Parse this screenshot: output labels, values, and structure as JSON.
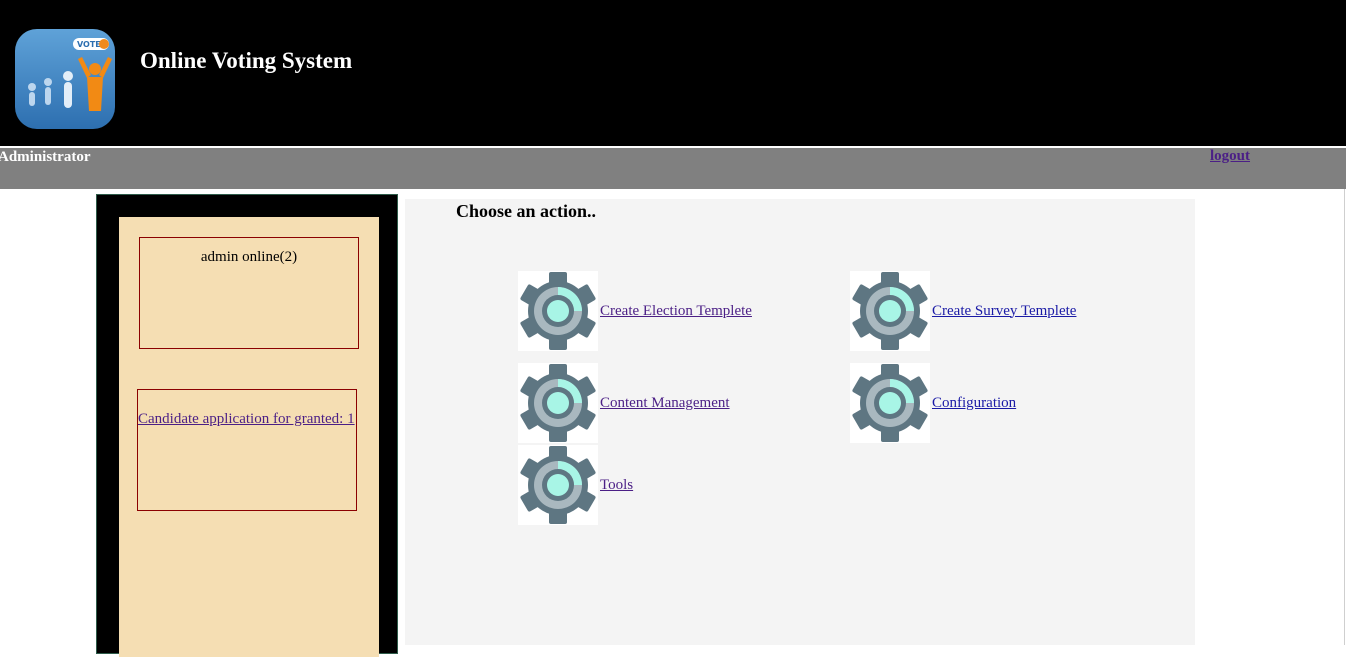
{
  "header": {
    "title": "Online Voting System",
    "logo_badge": "VOTE"
  },
  "topbar": {
    "role": "Administrator",
    "logout": "logout"
  },
  "sidebar": {
    "online_text": "admin online(2)",
    "candidate_link": "Candidate application for granted: 1"
  },
  "main": {
    "title": "Choose an action..",
    "actions": [
      {
        "label": "Create Election Templete",
        "icon": "gear-icon"
      },
      {
        "label": "Create Survey Templete",
        "icon": "gear-icon"
      },
      {
        "label": "Content Management",
        "icon": "gear-icon"
      },
      {
        "label": "Configuration",
        "icon": "gear-icon"
      },
      {
        "label": "Tools",
        "icon": "gear-icon"
      }
    ]
  },
  "colors": {
    "header_bg": "#000000",
    "topbar_bg": "#808080",
    "sidebar_bg": "#f5deb3",
    "box_border": "#8b0000",
    "main_bg": "#f4f4f4",
    "gear_dark": "#5d7480",
    "gear_accent": "#a8f5e6"
  }
}
